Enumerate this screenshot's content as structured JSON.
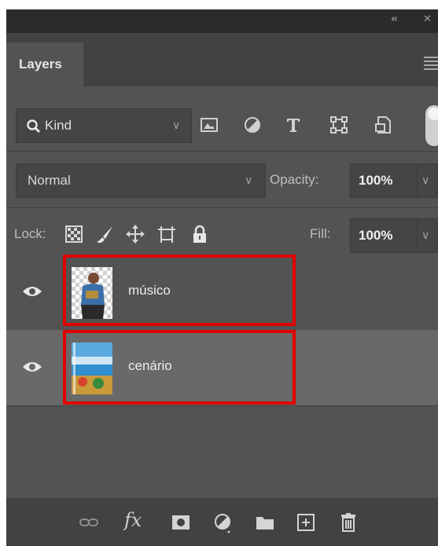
{
  "panel": {
    "title": "Layers",
    "collapse_icon": "double-chevron-left-icon",
    "close_icon": "close-icon",
    "menu_icon": "panel-menu-icon"
  },
  "filter": {
    "kind_label": "Kind",
    "icons": [
      "pixel-filter-icon",
      "adjustment-filter-icon",
      "type-filter-icon",
      "shape-filter-icon",
      "smart-object-filter-icon"
    ]
  },
  "blend": {
    "mode": "Normal",
    "opacity_label": "Opacity:",
    "opacity_value": "100%"
  },
  "lock": {
    "label": "Lock:",
    "icons": [
      "lock-transparent-pixels-icon",
      "lock-image-pixels-icon",
      "lock-position-icon",
      "lock-artboard-icon",
      "lock-all-icon"
    ],
    "fill_label": "Fill:",
    "fill_value": "100%"
  },
  "layers": [
    {
      "name": "músico",
      "visible": true,
      "selected": false,
      "highlighted": true
    },
    {
      "name": "cenário",
      "visible": true,
      "selected": true,
      "highlighted": true
    }
  ],
  "highlight_color": "#e00000",
  "bottom_bar": {
    "fx_label": "fx",
    "icons": [
      "link-layers-icon",
      "layer-style-icon",
      "layer-mask-icon",
      "adjustment-layer-icon",
      "group-folder-icon",
      "new-layer-icon",
      "delete-layer-icon"
    ]
  }
}
